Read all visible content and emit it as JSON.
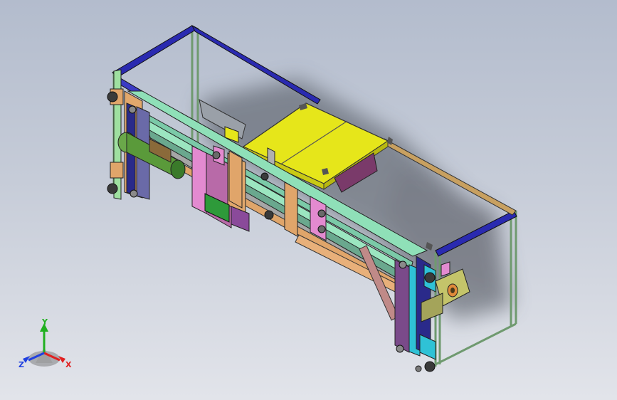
{
  "triad": {
    "x_label": "X",
    "y_label": "Y",
    "z_label": "Z"
  },
  "colors": {
    "background_top": "#b3bccd",
    "background_bottom": "#e2e4ea",
    "frame_blue": "#2a2ab0",
    "frame_green": "#9fe0a0",
    "rail_teal": "#86d6b6",
    "panel_yellow": "#e6e61a",
    "wood_orange": "#e0a56a",
    "pink": "#e38ad0",
    "purple": "#8a4a9a",
    "cyan": "#2fc2d6",
    "motor_olive": "#c4c46a",
    "axis_x": "#e02020",
    "axis_y": "#20b020",
    "axis_z": "#2040e0"
  }
}
